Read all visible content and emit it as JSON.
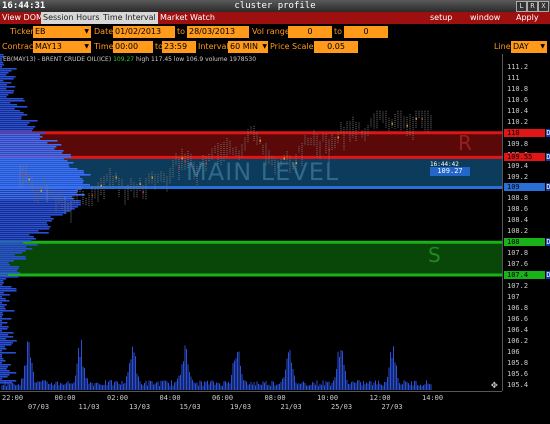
{
  "window": {
    "clock": "16:44:31",
    "title": "cluster profile",
    "buttons": [
      "L",
      "R",
      "X"
    ]
  },
  "menu": {
    "left": [
      "View DOM",
      "Session Hours",
      "Time Interval",
      "Market Watch"
    ],
    "right": [
      "setup",
      "window",
      "Apply"
    ],
    "selected": [
      "Session Hours",
      "Time Interval"
    ]
  },
  "params": {
    "ticker_label": "Ticker",
    "ticker": "EB",
    "date_label": "Date",
    "date_from": "01/02/2013",
    "to_label": "to",
    "date_to": "28/03/2013",
    "volrange_label": "Vol range",
    "vol_from": "0",
    "vol_to_label": "to",
    "vol_to": "0",
    "contract_label": "Contract",
    "contract": "MAY13",
    "time_label": "Time",
    "time_from": "00:00",
    "time_to_label": "to",
    "time_to": "23:59",
    "interval_label": "Interval",
    "interval": "60 MIN",
    "pricescale_label": "Price Scale",
    "price_scale": "0.05",
    "line_label": "Line",
    "line": "DAY"
  },
  "chart": {
    "info": {
      "symbol": "EB(MAY13) - BRENT CRUDE OIL(ICE)",
      "last": "109.27",
      "high": "high 117.45",
      "low": "low 106.9",
      "volume": "volume 1978530"
    },
    "zone_resistance": "R",
    "zone_support": "S",
    "main_level": "MAIN LEVEL",
    "cursor_time": "16:44:42",
    "cursor_price": "109.27",
    "y_ticks": [
      "111.2",
      "111",
      "110.8",
      "110.6",
      "110.4",
      "110.2",
      "110",
      "109.8",
      "109.6",
      "109.4",
      "109.2",
      "109",
      "108.8",
      "108.6",
      "108.4",
      "108.2",
      "108",
      "107.8",
      "107.6",
      "107.4",
      "107.2",
      "107",
      "106.8",
      "106.6",
      "106.4",
      "106.2",
      "106",
      "105.8",
      "105.6",
      "105.4"
    ],
    "levels": [
      {
        "price": "110",
        "color": "#e01515",
        "index": 6
      },
      {
        "price": "109.55",
        "color": "#e01515",
        "index": 8.25
      },
      {
        "price": "109",
        "color": "#2a6fd8",
        "index": 11
      },
      {
        "price": "108",
        "color": "#19b319",
        "index": 16
      },
      {
        "price": "107.4",
        "color": "#19b319",
        "index": 19
      }
    ],
    "x_times": [
      "22:00",
      "00:00",
      "02:00",
      "04:00",
      "06:00",
      "08:00",
      "10:00",
      "12:00",
      "14:00"
    ],
    "x_dates": [
      "07/03",
      "11/03",
      "13/03",
      "15/03",
      "19/03",
      "21/03",
      "25/03",
      "27/03"
    ]
  },
  "colors": {
    "menu_bg": "#9e1010",
    "param_orange": "#ff9a1a",
    "resistance": "#c01010",
    "main": "#1f6fa8",
    "support": "#119911",
    "volume_blue": "#2a4fd8"
  }
}
